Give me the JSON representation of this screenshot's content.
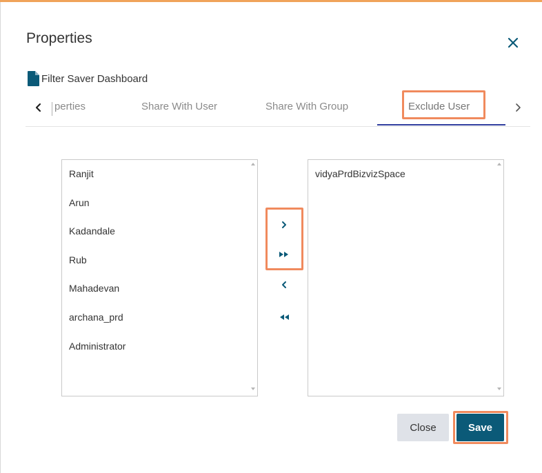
{
  "dialog": {
    "title": "Properties",
    "close_icon": "close-icon"
  },
  "document": {
    "icon": "file-icon",
    "name": "Filter Saver Dashboard"
  },
  "tabs": {
    "items": [
      {
        "label": "Properties",
        "visible_text": "perties",
        "clipped": true
      },
      {
        "label": "Share With User"
      },
      {
        "label": "Share With Group"
      },
      {
        "label": "Exclude User",
        "active": true
      }
    ],
    "scroll_left_icon": "chevron-left-icon",
    "scroll_right_icon": "chevron-right-icon"
  },
  "available_users": [
    "Ranjit",
    "Arun",
    "Kadandale",
    "Rub",
    "Mahadevan",
    "archana_prd",
    "Administrator"
  ],
  "excluded_users": [
    "vidyaPrdBizvizSpace"
  ],
  "transfer_buttons": {
    "move_right_icon": "chevron-right-icon",
    "move_all_right_icon": "double-chevron-right-icon",
    "move_left_icon": "chevron-left-icon",
    "move_all_left_icon": "double-chevron-left-icon"
  },
  "footer": {
    "close_label": "Close",
    "save_label": "Save"
  },
  "colors": {
    "accent": "#0b5a78",
    "highlight": "#f08a5d",
    "active_tab_underline": "#2f3e9e"
  }
}
